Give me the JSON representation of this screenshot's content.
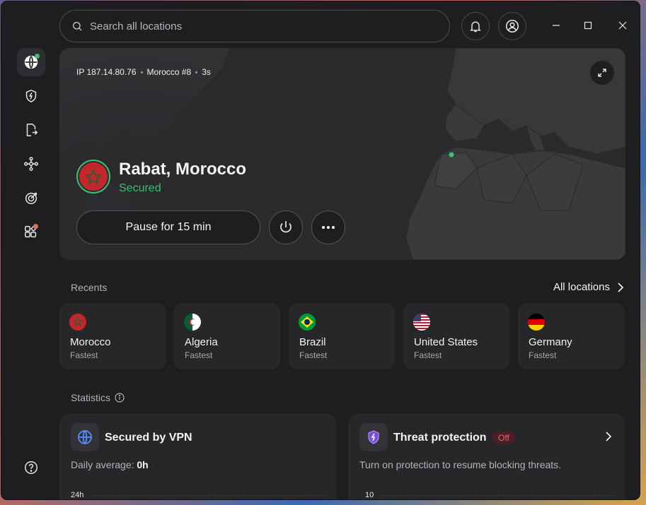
{
  "search": {
    "placeholder": "Search all locations"
  },
  "connection": {
    "ip": "IP 187.14.80.76",
    "server": "Morocco #8",
    "duration": "3s",
    "location": "Rabat, Morocco",
    "status": "Secured",
    "pause_label": "Pause for 15 min"
  },
  "recents": {
    "label": "Recents",
    "all_locations": "All locations",
    "items": [
      {
        "name": "Morocco",
        "sub": "Fastest"
      },
      {
        "name": "Algeria",
        "sub": "Fastest"
      },
      {
        "name": "Brazil",
        "sub": "Fastest"
      },
      {
        "name": "United States",
        "sub": "Fastest"
      },
      {
        "name": "Germany",
        "sub": "Fastest"
      }
    ]
  },
  "statistics": {
    "label": "Statistics",
    "vpn": {
      "title": "Secured by VPN",
      "daily_label": "Daily average: ",
      "daily_value": "0h",
      "axis_top": "24h"
    },
    "threat": {
      "title": "Threat protection",
      "badge": "Off",
      "desc": "Turn on protection to resume blocking threats.",
      "axis_top": "10"
    }
  },
  "colors": {
    "accent_green": "#3fbf6e",
    "notify_dot": "#e86a5a",
    "status_off": "#e86a6a"
  }
}
